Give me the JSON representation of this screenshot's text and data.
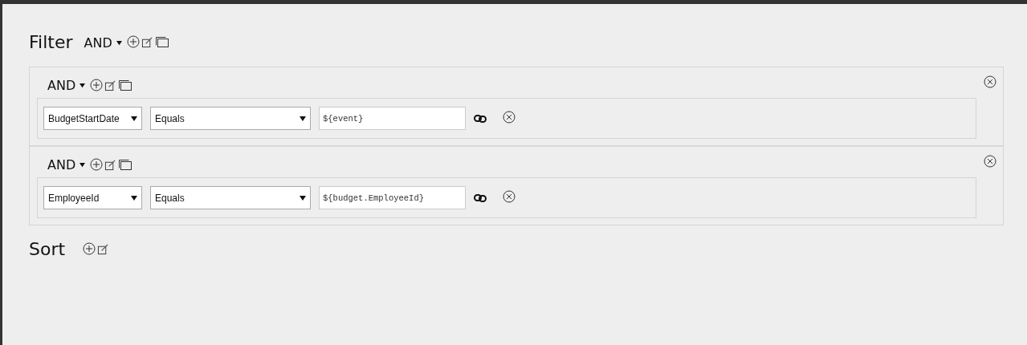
{
  "filter": {
    "title": "Filter",
    "operator": "AND",
    "groups": [
      {
        "operator": "AND",
        "conditions": [
          {
            "field": "BudgetStartDate",
            "comparison": "Equals",
            "value": "${event}"
          }
        ]
      },
      {
        "operator": "AND",
        "conditions": [
          {
            "field": "EmployeeId",
            "comparison": "Equals",
            "value": "${budget.EmployeeId}"
          }
        ]
      }
    ]
  },
  "sort": {
    "title": "Sort"
  }
}
